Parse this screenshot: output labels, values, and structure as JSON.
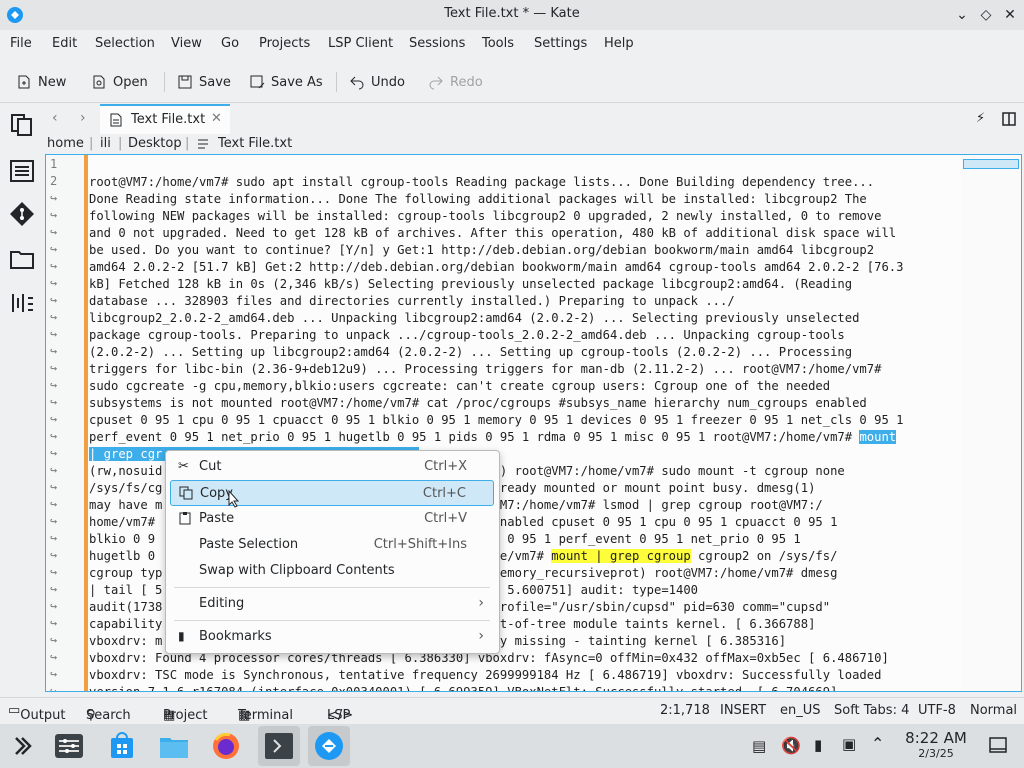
{
  "window": {
    "title": "Text File.txt * — Kate"
  },
  "menu": [
    "File",
    "Edit",
    "Selection",
    "View",
    "Go",
    "Projects",
    "LSP Client",
    "Sessions",
    "Tools",
    "Settings",
    "Help"
  ],
  "toolbar": {
    "new": "New",
    "open": "Open",
    "save": "Save",
    "save_as": "Save As",
    "undo": "Undo",
    "redo": "Redo"
  },
  "tab": {
    "label": "Text File.txt"
  },
  "breadcrumb": [
    "home",
    "ili",
    "Desktop",
    "Text File.txt"
  ],
  "line_numbers": [
    "1",
    "2"
  ],
  "code_lines": [
    "",
    "root@VM7:/home/vm7# sudo apt install cgroup-tools Reading package lists... Done Building dependency tree...",
    "Done Reading state information... Done The following additional packages will be installed: libcgroup2 The",
    "following NEW packages will be installed: cgroup-tools libcgroup2 0 upgraded, 2 newly installed, 0 to remove",
    "and 0 not upgraded. Need to get 128 kB of archives. After this operation, 480 kB of additional disk space will",
    "be used. Do you want to continue? [Y/n] y Get:1 http://deb.debian.org/debian bookworm/main amd64 libcgroup2",
    "amd64 2.0.2-2 [51.7 kB] Get:2 http://deb.debian.org/debian bookworm/main amd64 cgroup-tools amd64 2.0.2-2 [76.3",
    "kB] Fetched 128 kB in 0s (2,346 kB/s) Selecting previously unselected package libcgroup2:amd64. (Reading",
    "database ... 328903 files and directories currently installed.) Preparing to unpack .../",
    "libcgroup2_2.0.2-2_amd64.deb ... Unpacking libcgroup2:amd64 (2.0.2-2) ... Selecting previously unselected",
    "package cgroup-tools. Preparing to unpack .../cgroup-tools_2.0.2-2_amd64.deb ... Unpacking cgroup-tools",
    "(2.0.2-2) ... Setting up libcgroup2:amd64 (2.0.2-2) ... Setting up cgroup-tools (2.0.2-2) ... Processing",
    "triggers for libc-bin (2.36-9+deb12u9) ... Processing triggers for man-db (2.11.2-2) ... root@VM7:/home/vm7#",
    "sudo cgcreate -g cpu,memory,blkio:users cgcreate: can't create cgroup users: Cgroup one of the needed",
    "subsystems is not mounted root@VM7:/home/vm7# cat /proc/cgroups #subsys_name hierarchy num_cgroups enabled",
    "cpuset 0 95 1 cpu 0 95 1 cpuacct 0 95 1 blkio 0 95 1 memory 0 95 1 devices 0 95 1 freezer 0 95 1 net_cls 0 95 1",
    "perf_event 0 95 1 net_prio 0 95 1 hugetlb 0 95 1 pids 0 95 1 rdma 0 95 1 misc 0 95 1 root@VM7:/home/vm7# ",
    "| grep cgr                                   ",
    "(rw,nosuid                                  ecursiveprot) root@VM7:/home/vm7# sudo mount -t cgroup none",
    "/sys/fs/cg                                  oup: none already mounted or mount point busy. dmesg(1)",
    "may have m                                  tall. root@VM7:/home/vm7# lsmod | grep cgroup root@VM7:/",
    "home/vm7#                                   um_cgroups enabled cpuset 0 95 1 cpu 0 95 1 cpuacct 0 95 1",
    "blkio 0 9                                   95 1 net_cls 0 95 1 perf_event 0 95 1 net_prio 0 95 1",
    "hugetlb 0                                   oot@VM7:/home/vm7# ",
    "cgroup typ                                  nsdelegate,memory_recursiveprot) root@VM7:/home/vm7# dmesg",
    "| tail [ 5                                  suppressed [ 5.600751] audit: type=1400",
    "audit(1738                                  =\"capable\" profile=\"/usr/sbin/cupsd\" pid=630 comm=\"cupsd\"",
    "capability                                  : loading out-of-tree module taints kernel. [ 6.366788]",
    "vboxdrv: m                                   required key missing - tainting kernel [ 6.385316]",
    "vboxdrv: Found 4 processor cores/threads [ 6.386330] vboxdrv: fAsync=0 offMin=0x432 offMax=0xb5ec [ 6.486710]",
    "vboxdrv: TSC mode is Synchronous, tentative frequency 2699999184 Hz [ 6.486719] vboxdrv: Successfully loaded",
    "version 7.1.6 r167084 (interface 0x00340001) [ 6.699359] VBoxNetFlt: Successfully started. [ 6.704669]"
  ],
  "selected_text": "mount",
  "highlight_text": "mount | grep cgroup",
  "highlight_after": " cgroup2 on /sys/fs/",
  "context_menu": {
    "cut": {
      "label": "Cut",
      "shortcut": "Ctrl+X"
    },
    "copy": {
      "label": "Copy",
      "shortcut": "Ctrl+C"
    },
    "paste": {
      "label": "Paste",
      "shortcut": "Ctrl+V"
    },
    "paste_selection": {
      "label": "Paste Selection",
      "shortcut": "Ctrl+Shift+Ins"
    },
    "swap": {
      "label": "Swap with Clipboard Contents"
    },
    "editing": {
      "label": "Editing"
    },
    "bookmarks": {
      "label": "Bookmarks"
    }
  },
  "statusbar": {
    "output": "Output",
    "search": "Search",
    "project": "Project",
    "terminal": "Terminal",
    "lsp": "LSP",
    "position": "2:1,718",
    "mode": "INSERT",
    "language": "en_US",
    "tabs": "Soft Tabs: 4",
    "encoding": "UTF-8",
    "highlight": "Normal"
  },
  "clock": {
    "time": "8:22 AM",
    "date": "2/3/25"
  },
  "colors": {
    "accent": "#3daee9",
    "highlight": "#fdfd3a",
    "modified": "#f0a040"
  }
}
